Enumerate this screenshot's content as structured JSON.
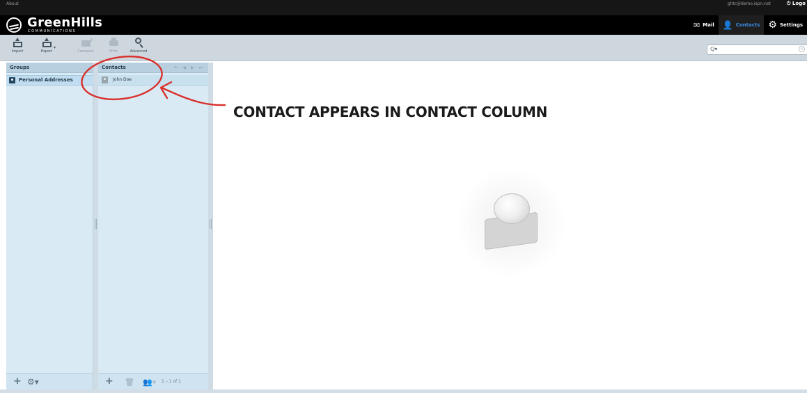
{
  "topbar": {
    "about": "About",
    "username": "ghtc@demo.ispn.net",
    "logout": "Logo"
  },
  "header": {
    "logo_name": "GreenHills",
    "logo_sub": "COMMUNICATIONS",
    "nav": [
      {
        "label": "Mail",
        "icon": "mail-icon"
      },
      {
        "label": "Contacts",
        "icon": "contacts-icon",
        "selected": true
      },
      {
        "label": "Settings",
        "icon": "gear-icon"
      }
    ]
  },
  "toolbar": {
    "import_label": "Import",
    "export_label": "Export",
    "compose_label": "Compose",
    "print_label": "Print",
    "advanced_label": "Advanced"
  },
  "search": {
    "placeholder": ""
  },
  "groups": {
    "title": "Groups",
    "items": [
      {
        "label": "Personal Addresses",
        "selected": true
      }
    ]
  },
  "contacts": {
    "title": "Contacts",
    "items": [
      {
        "label": "John Doe"
      }
    ],
    "count": "1 – 1 of 1"
  },
  "annotation": {
    "text": "CONTACT APPEARS IN CONTACT COLUMN",
    "color": "#d9302b"
  },
  "colors": {
    "accent": "#3a8ee6",
    "panel_bg": "#d9eaf5",
    "panel_head": "#b7cfdf",
    "toolbar_bg": "#cfd7de"
  }
}
